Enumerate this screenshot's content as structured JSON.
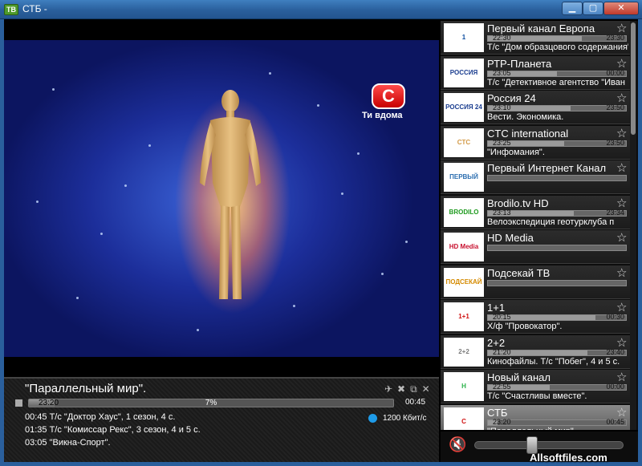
{
  "window": {
    "title": "СТБ -",
    "app_icon": "TB",
    "min_label": "▁",
    "max_label": "▢",
    "close_label": "✕"
  },
  "video": {
    "logo_glyph": "С",
    "logo_text": "Ти вдома"
  },
  "now_playing": {
    "title": "\"Параллельный мир\".",
    "start": "23:20",
    "end": "00:45",
    "percent": "7%",
    "progress": 0.07,
    "tools": "✈✖⧉✕",
    "stop_icon": "stop-icon",
    "schedule": [
      "00:45 Т/с \"Доктор Хаус\", 1 сезон, 4 с.",
      "01:35 Т/с \"Комиссар Рекс\", 3 сезон, 4 и 5 с.",
      "03:05 \"Викна-Спорт\"."
    ],
    "bitrate": "1200 Кбит/с",
    "bitrate_color": "#1e9be8"
  },
  "channels": [
    {
      "name": "Первый канал Европа",
      "logo": "1",
      "logo_color": "#0f4ea0",
      "start": "22:30",
      "end": "23:30",
      "progress": 0.68,
      "program": "Т/с \"Дом образцового содержания\""
    },
    {
      "name": "РТР-Планета",
      "logo": "РОССИЯ РТР",
      "logo_color": "#1a3d8f",
      "start": "23:05",
      "end": "00:00",
      "progress": 0.5,
      "program": "Т/с \"Детективное агентство \"Иван"
    },
    {
      "name": "Россия 24",
      "logo": "РОССИЯ 24",
      "logo_color": "#1a3d8f",
      "start": "23:10",
      "end": "23:50",
      "progress": 0.6,
      "program": "Вести. Экономика."
    },
    {
      "name": "CTC international",
      "logo": "CTC",
      "logo_color": "#d39a47",
      "start": "23:25",
      "end": "23:50",
      "progress": 0.55,
      "program": "\"Инфомания\"."
    },
    {
      "name": "Первый Интернет Канал",
      "logo": "ПЕРВЫЙ ИНТЕРНЕТ",
      "logo_color": "#2d6fb0",
      "start": "",
      "end": "",
      "progress": 0,
      "program": ""
    },
    {
      "name": "Brodilo.tv HD",
      "logo": "BRODILO",
      "logo_color": "#1e9a1e",
      "start": "23:13",
      "end": "23:34",
      "progress": 0.62,
      "program": "Велоэкспедиция геотурклуба п"
    },
    {
      "name": "HD Media",
      "logo": "HD Media",
      "logo_color": "#c8102e",
      "start": "",
      "end": "",
      "progress": 0,
      "program": ""
    },
    {
      "name": "Подсекай ТВ",
      "logo": "ПОДСЕКАЙ ТВ",
      "logo_color": "#d48a00",
      "start": "",
      "end": "",
      "progress": 0,
      "program": ""
    },
    {
      "name": "1+1",
      "logo": "1+1",
      "logo_color": "#d01010",
      "start": "20:15",
      "end": "00:30",
      "progress": 0.78,
      "program": "Х/ф \"Провокатор\"."
    },
    {
      "name": "2+2",
      "logo": "2+2",
      "logo_color": "#7a7a7a",
      "start": "21:20",
      "end": "23:40",
      "progress": 0.72,
      "program": "Кинофайлы. Т/с \"Побег\", 4 и 5 с."
    },
    {
      "name": "Новый канал",
      "logo": "Н",
      "logo_color": "#2bb24a",
      "start": "22:55",
      "end": "00:00",
      "progress": 0.45,
      "program": "Т/с \"Счастливы вместе\"."
    },
    {
      "name": "СТБ",
      "logo": "С",
      "logo_color": "#d01010",
      "start": "23:20",
      "end": "00:45",
      "progress": 0.07,
      "program": "\"Параллельный мир\".",
      "active": true
    }
  ],
  "volume": {
    "icon": "🔇",
    "level": 0.38
  },
  "watermark": "Allsoftfiles.com"
}
